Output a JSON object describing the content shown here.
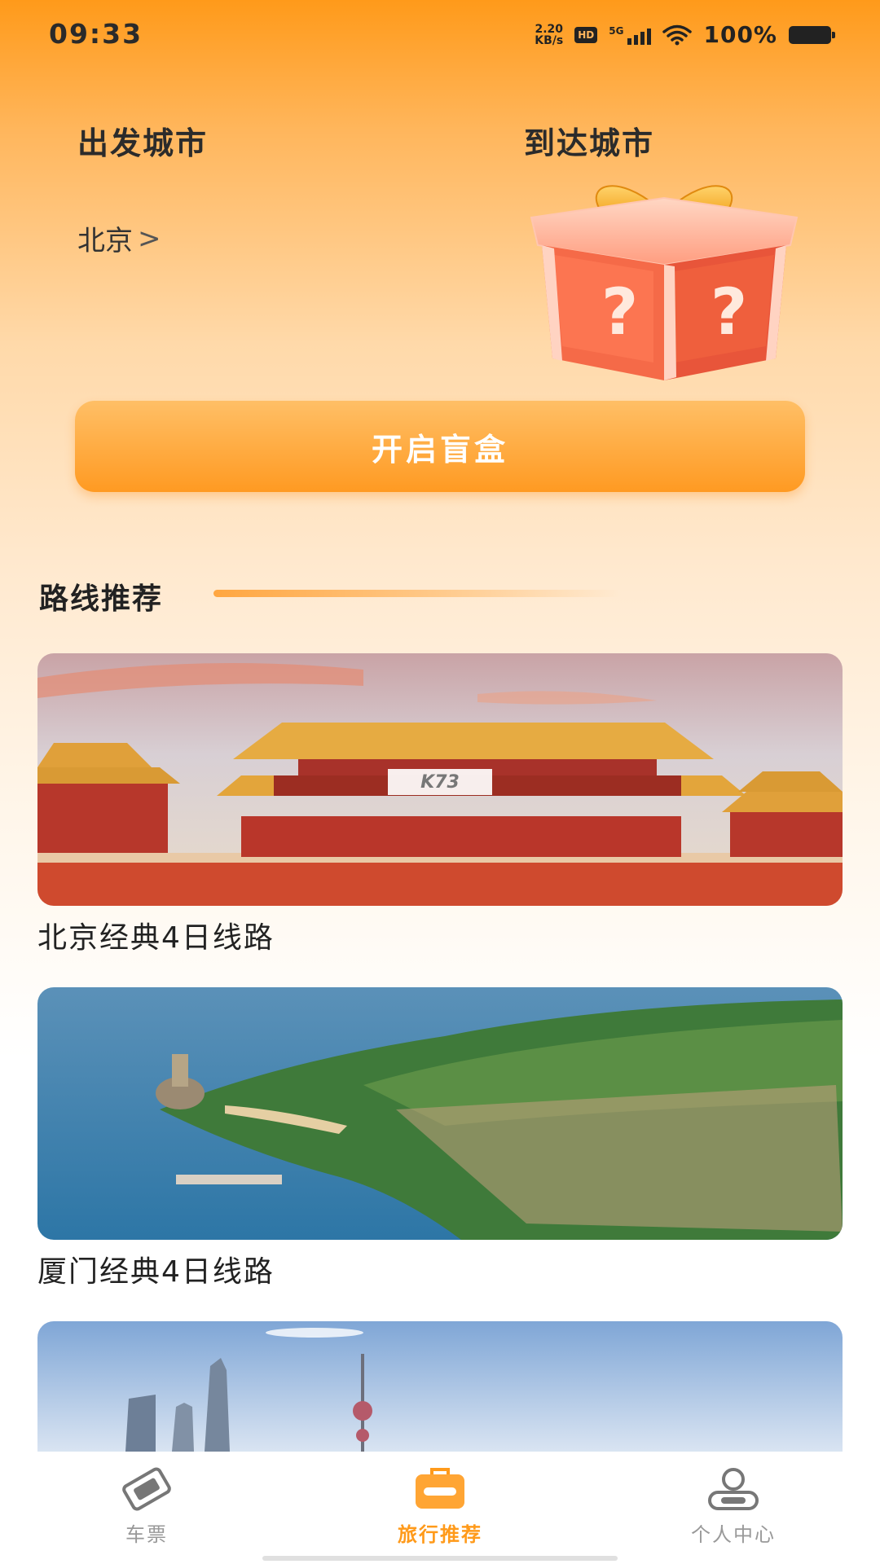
{
  "status_bar": {
    "time": "09:33",
    "net_speed_value": "2.20",
    "net_speed_unit": "KB/s",
    "hd": "HD",
    "network": "5G",
    "battery": "100%"
  },
  "header": {
    "departure_label": "出发城市",
    "arrival_label": "到达城市",
    "departure_city": "北京",
    "chevron": ">"
  },
  "open_button_label": "开启盲盒",
  "section": {
    "title": "路线推荐"
  },
  "routes": [
    {
      "title": "北京经典4日线路"
    },
    {
      "title": "厦门经典4日线路"
    },
    {
      "title": ""
    }
  ],
  "watermark": "K73",
  "tabs": [
    {
      "label": "车票",
      "icon": "ticket-icon",
      "active": false
    },
    {
      "label": "旅行推荐",
      "icon": "suitcase-icon",
      "active": true
    },
    {
      "label": "个人中心",
      "icon": "person-icon",
      "active": false
    }
  ],
  "colors": {
    "accent": "#ff9a1a",
    "button_top": "#ffbf66",
    "button_bottom": "#ff9a22",
    "inactive_tab": "#999999"
  }
}
